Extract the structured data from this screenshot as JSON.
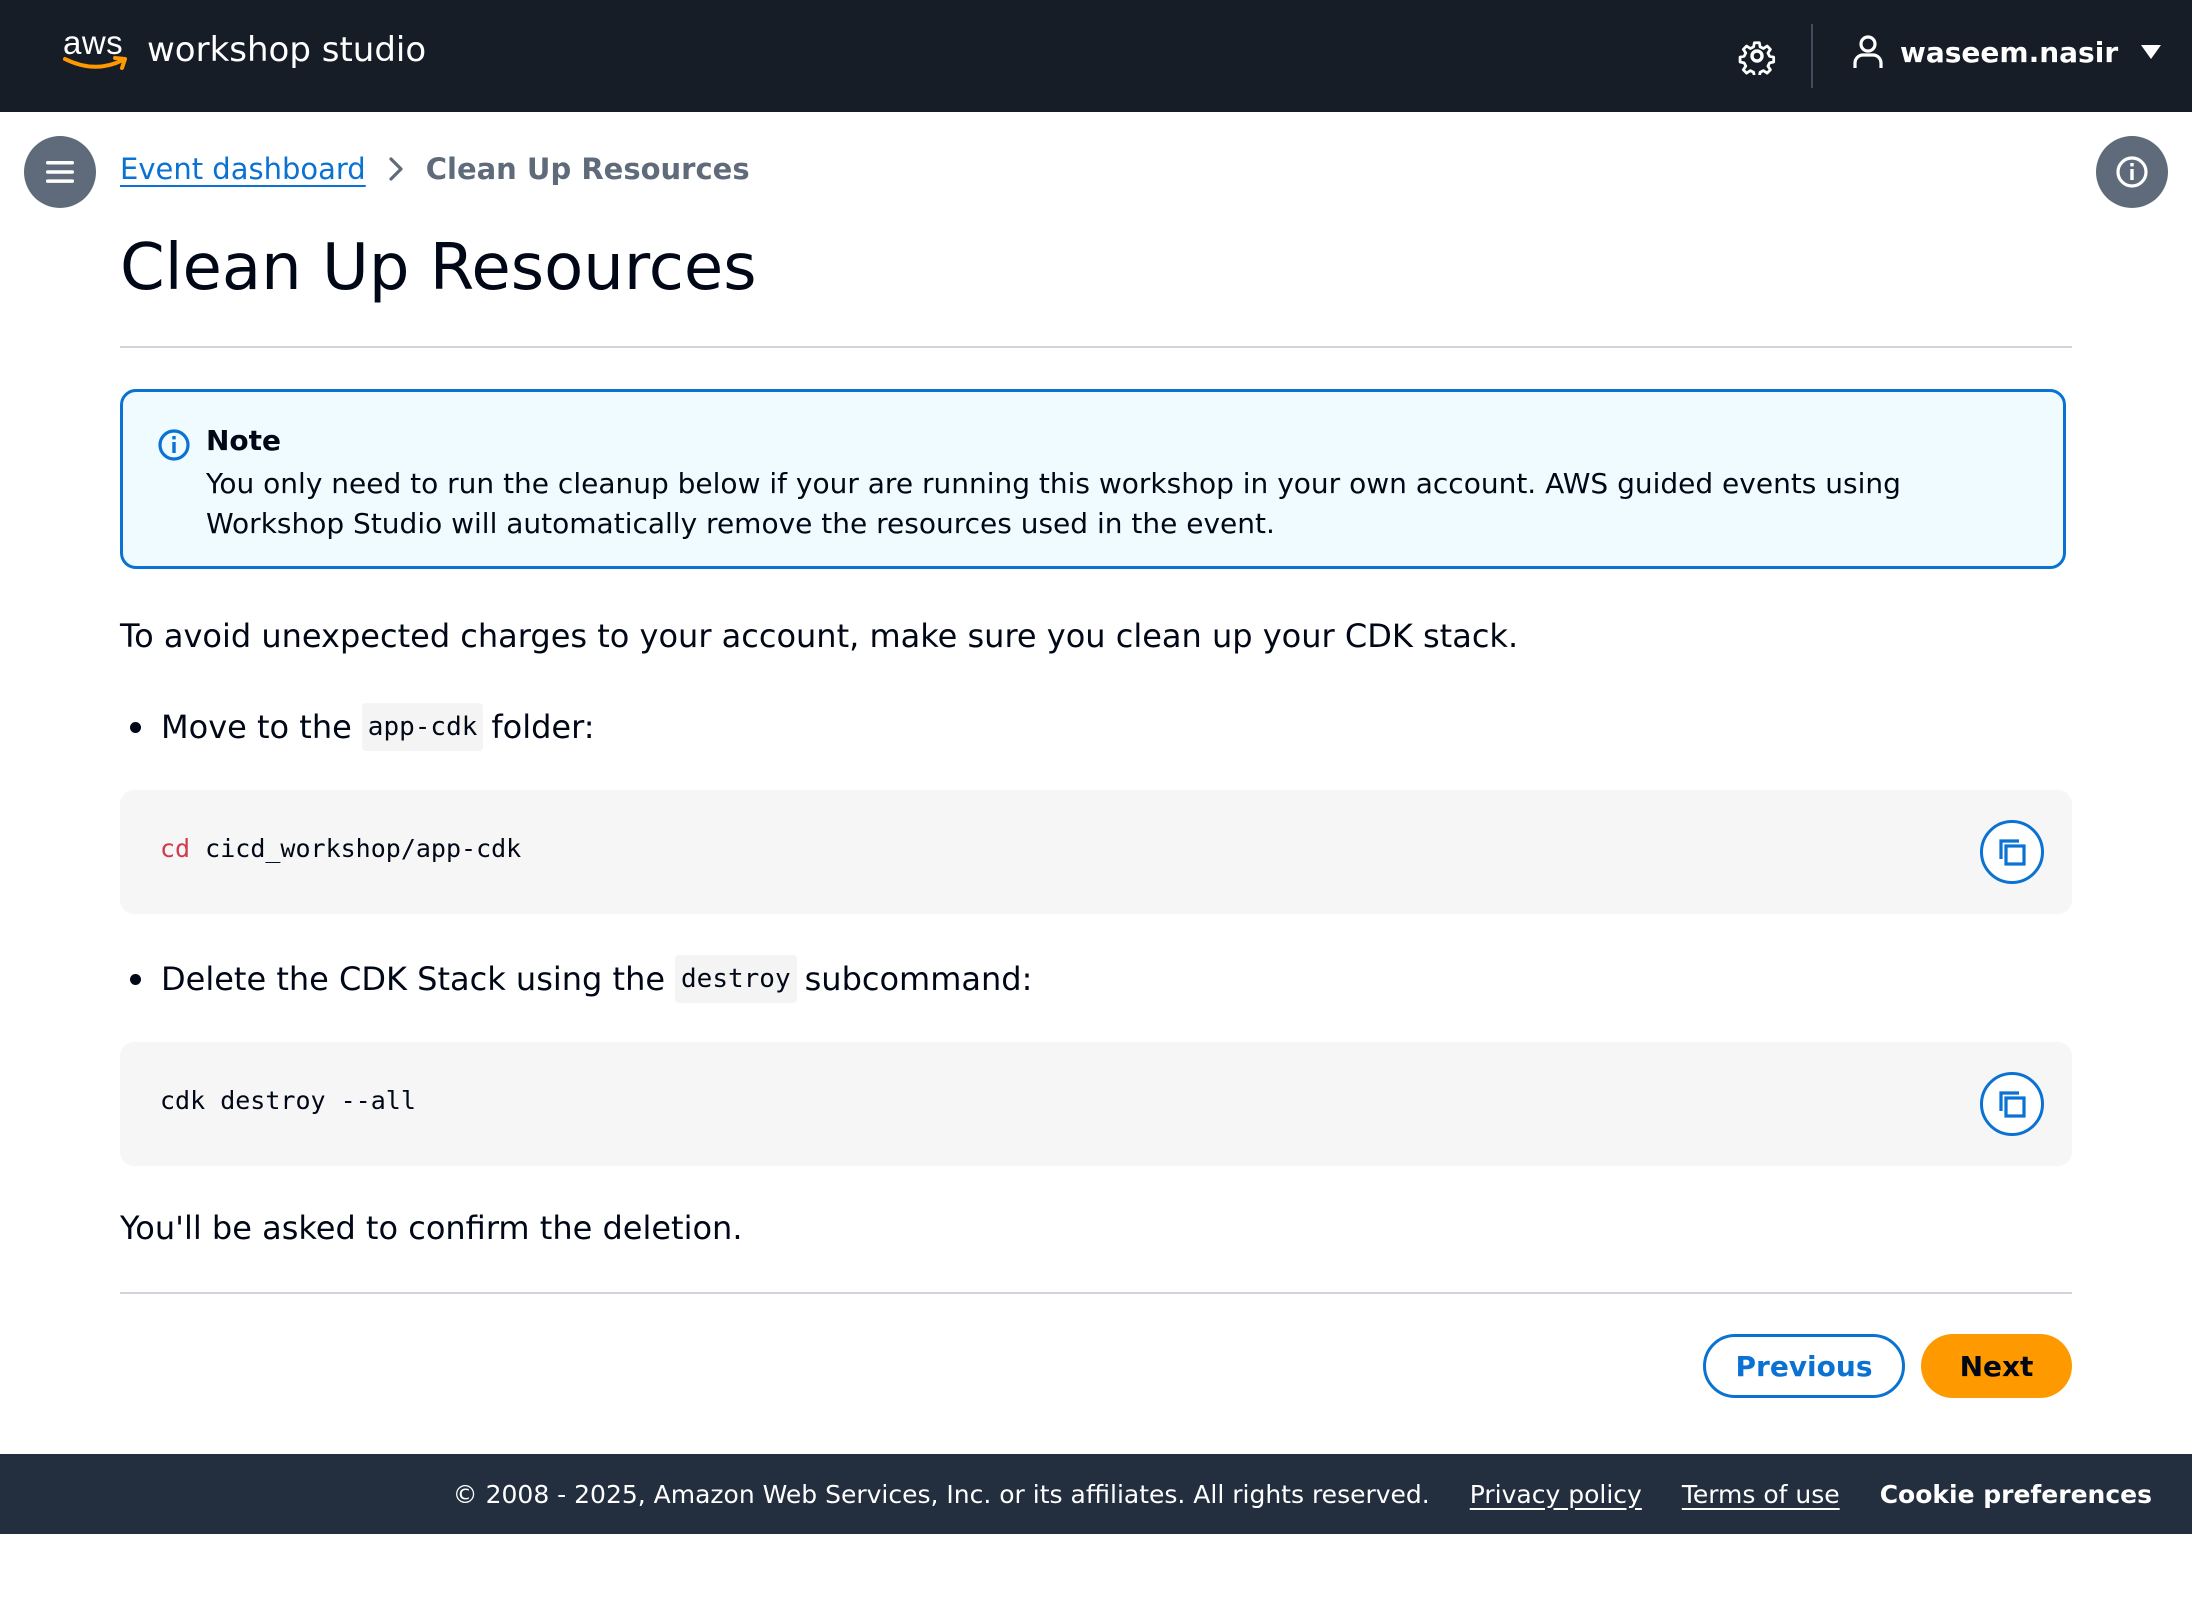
{
  "header": {
    "brand_logo_text": "aws",
    "brand_name": "workshop studio",
    "user_name": "waseem.nasir"
  },
  "breadcrumb": {
    "link": "Event dashboard",
    "current": "Clean Up Resources"
  },
  "page": {
    "title": "Clean Up Resources"
  },
  "note": {
    "title": "Note",
    "body": "You only need to run the cleanup below if your are running this workshop in your own account. AWS guided events using Workshop Studio will automatically remove the resources used in the event."
  },
  "content": {
    "intro": "To avoid unexpected charges to your account, make sure you clean up your CDK stack.",
    "step1": {
      "before": "Move to the",
      "code": "app-cdk",
      "after": "folder:"
    },
    "code1": {
      "keyword": "cd",
      "rest": " cicd_workshop/app-cdk"
    },
    "step2": {
      "before": "Delete the CDK Stack using the",
      "code": "destroy",
      "after": "subcommand:"
    },
    "code2": {
      "text": "cdk destroy --all"
    },
    "outro": "You'll be asked to confirm the deletion."
  },
  "nav_buttons": {
    "previous": "Previous",
    "next": "Next"
  },
  "footer": {
    "copyright": "© 2008 - 2025, Amazon Web Services, Inc. or its affiliates. All rights reserved.",
    "privacy": "Privacy policy",
    "terms": "Terms of use",
    "cookies": "Cookie preferences"
  },
  "colors": {
    "header_bg": "#161d26",
    "footer_bg": "#232f3e",
    "link": "#0972d3",
    "primary_button": "#ff9900",
    "note_bg": "#f0fbff"
  }
}
